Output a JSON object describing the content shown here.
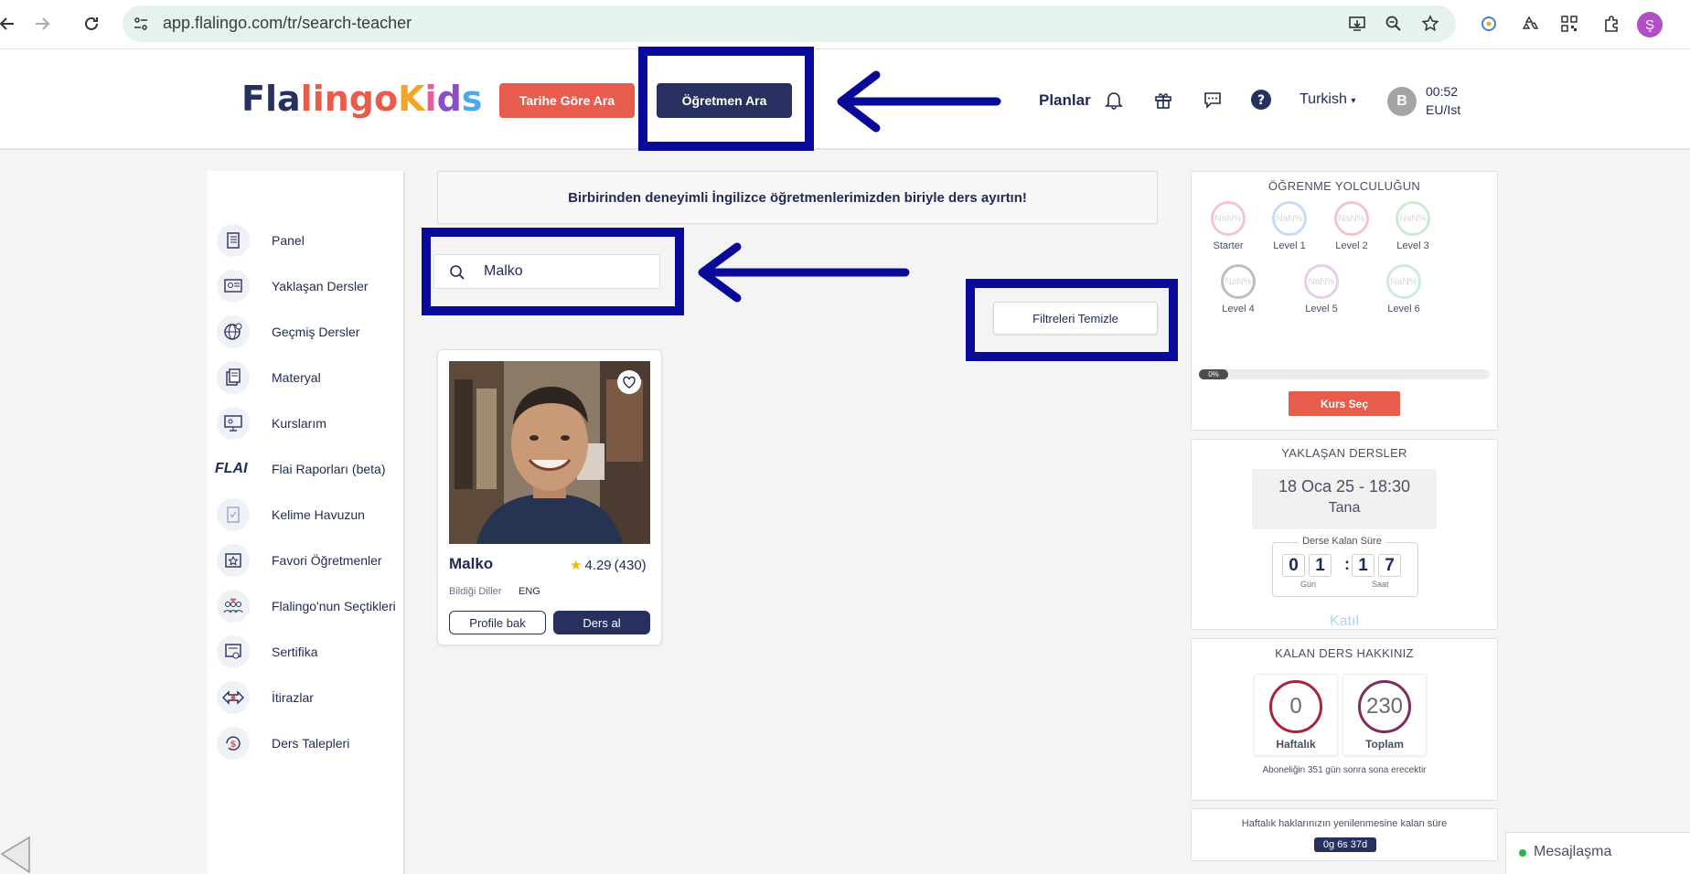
{
  "browser": {
    "url": "app.flalingo.com/tr/search-teacher",
    "profile_initial": "Ş"
  },
  "header": {
    "logo_text": "Flalingo Kids",
    "btn_date_search": "Tarihe Göre Ara",
    "btn_teacher_search": "Öğretmen Ara",
    "plans": "Planlar",
    "language": "Turkish",
    "avatar_initial": "B",
    "time": "00:52",
    "timezone": "EU/Ist"
  },
  "sidebar": {
    "items": [
      {
        "label": "Panel",
        "icon": "notebook-icon"
      },
      {
        "label": "Yaklaşan Dersler",
        "icon": "upcoming-lessons-icon"
      },
      {
        "label": "Geçmiş Dersler",
        "icon": "globe-clock-icon"
      },
      {
        "label": "Materyal",
        "icon": "documents-icon"
      },
      {
        "label": "Kurslarım",
        "icon": "monitor-icon"
      },
      {
        "label": "Flai Raporları (beta)",
        "icon": "flai-logo"
      },
      {
        "label": "Kelime Havuzun",
        "icon": "word-pool-icon"
      },
      {
        "label": "Favori Öğretmenler",
        "icon": "star-board-icon"
      },
      {
        "label": "Flalingo'nun Seçtikleri",
        "icon": "people-hearts-icon"
      },
      {
        "label": "Sertifika",
        "icon": "certificate-icon"
      },
      {
        "label": "İtirazlar",
        "icon": "objection-icon"
      },
      {
        "label": "Ders Talepleri",
        "icon": "dollar-request-icon"
      }
    ],
    "flai_text": "FLAI"
  },
  "main": {
    "banner": "Birbirinden deneyimli İngilizce öğretmenlerimizden biriyle ders ayırtın!",
    "search_value": "Malko",
    "clear_filters": "Filtreleri Temizle",
    "teacher": {
      "name": "Malko",
      "rating": "4.29",
      "reviews": "(430)",
      "languages_label": "Bildiği Diller",
      "languages": "ENG",
      "profile_button": "Profile bak",
      "lesson_button": "Ders al"
    }
  },
  "journey": {
    "title": "ÖĞRENME YOLCULUĞUN",
    "nan": "NaN%",
    "levels": [
      "Starter",
      "Level 1",
      "Level 2",
      "Level 3",
      "Level 4",
      "Level 5",
      "Level 6"
    ],
    "level_colors": [
      "#f3c6cc",
      "#c7dcf3",
      "#f3c6cc",
      "#cdebd3",
      "#bdbdbd",
      "#e6cdeb",
      "#cdebe2"
    ],
    "progress_percent": 0,
    "progress_label": "0%",
    "course_button": "Kurs Seç"
  },
  "upcoming": {
    "title": "YAKLAŞAN DERSLER",
    "date": "18 Oca 25 - 18:30",
    "teacher": "Tana",
    "countdown_title": "Derse Kalan Süre",
    "digits": [
      "0",
      "1",
      "1",
      "7"
    ],
    "separator": ":",
    "unit_day": "Gün",
    "unit_hour": "Saat",
    "join": "Katıl"
  },
  "quota": {
    "title": "KALAN DERS HAKKINIZ",
    "weekly_value": "0",
    "weekly_label": "Haftalık",
    "total_value": "230",
    "total_label": "Toplam",
    "subscription_note": "Aboneliğin 351 gün sonra sona erecektir"
  },
  "renewal": {
    "text": "Haftalık haklarınızın yenilenmesine kalan süre",
    "badge": "0g 6s 37d"
  },
  "messaging": {
    "label": "Mesajlaşma"
  },
  "colors": {
    "navy": "#27305e",
    "coral": "#e85c4e",
    "highlight": "#0a0a9a"
  }
}
